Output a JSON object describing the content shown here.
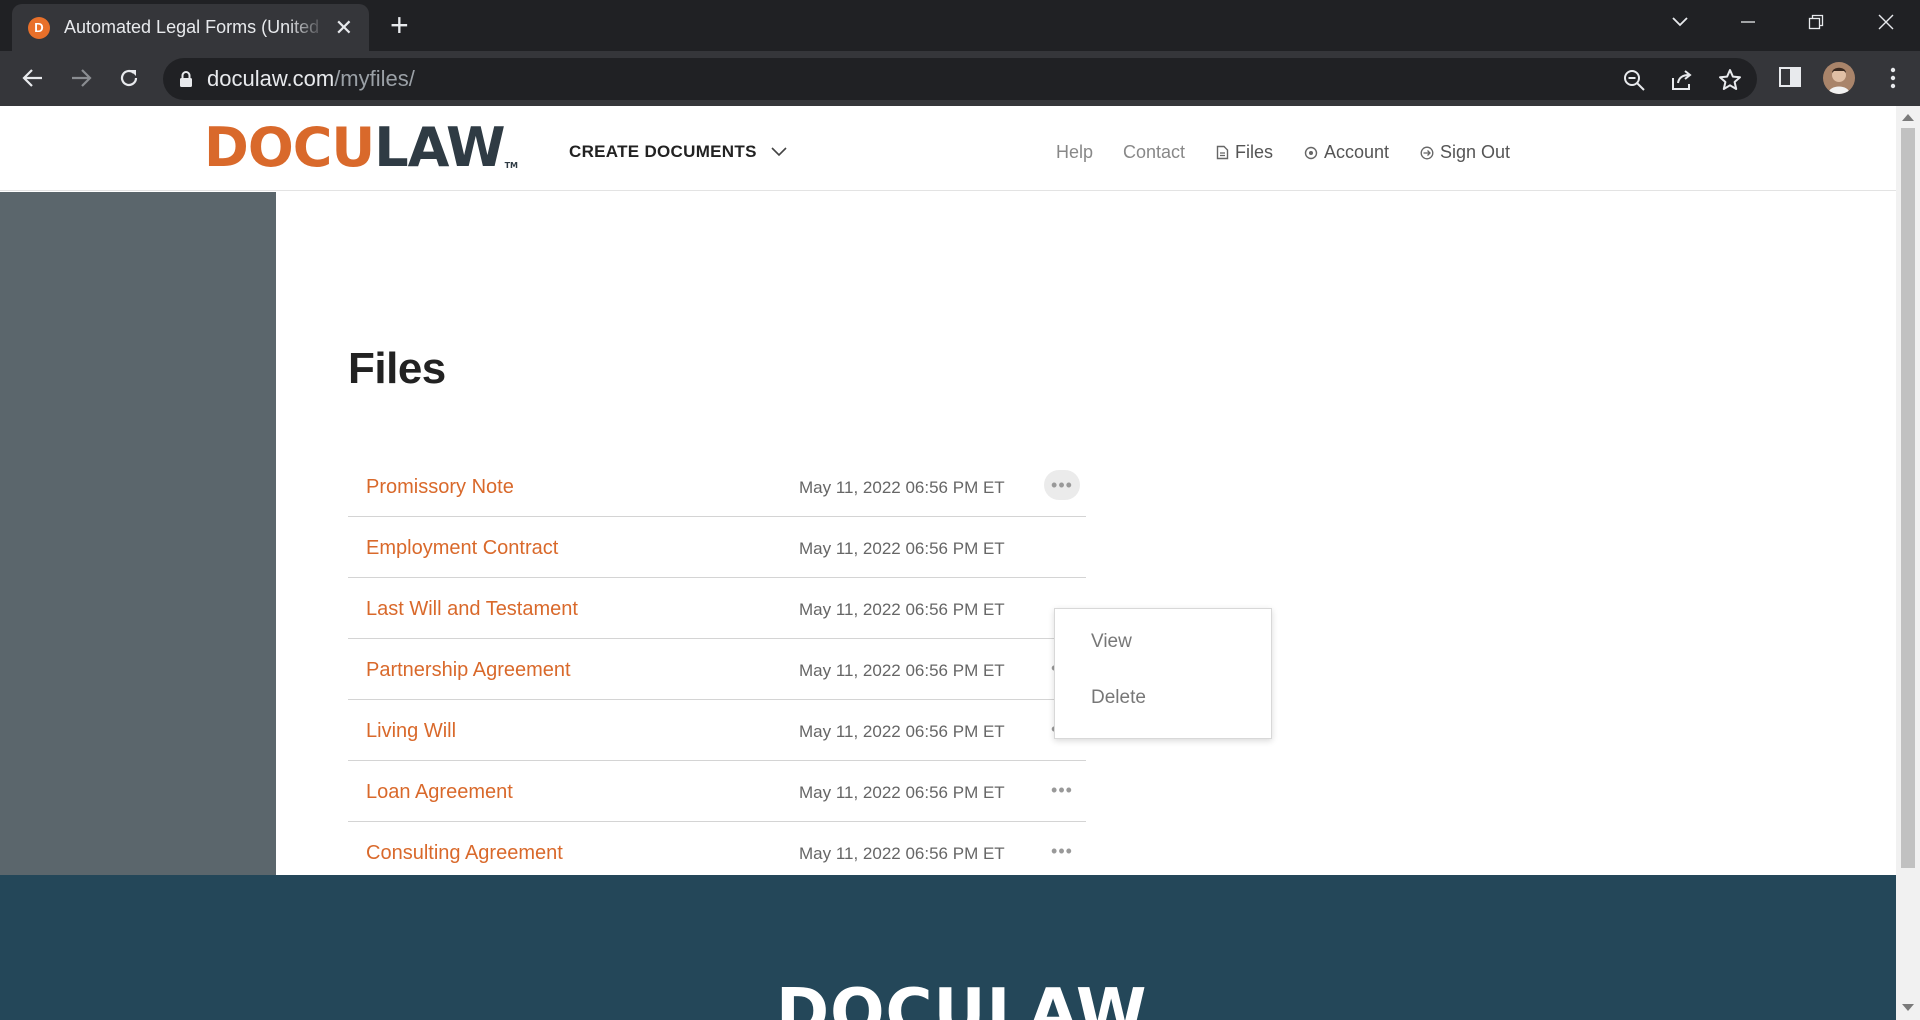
{
  "browser": {
    "tab_title": "Automated Legal Forms (United States)",
    "favicon_letter": "D",
    "url_host": "doculaw.com",
    "url_path": "/myfiles/"
  },
  "header": {
    "logo_part1": "DOCU",
    "logo_part2": "LAW",
    "logo_tm": "TM",
    "create_documents": "CREATE DOCUMENTS",
    "nav": {
      "help": "Help",
      "contact": "Contact",
      "files": "Files",
      "account": "Account",
      "sign_out": "Sign Out"
    }
  },
  "main": {
    "title": "Files",
    "files": [
      {
        "name": "Promissory Note",
        "date": "May 11, 2022 06:56 PM ET"
      },
      {
        "name": "Employment Contract",
        "date": "May 11, 2022 06:56 PM ET"
      },
      {
        "name": "Last Will and Testament",
        "date": "May 11, 2022 06:56 PM ET"
      },
      {
        "name": "Partnership Agreement",
        "date": "May 11, 2022 06:56 PM ET"
      },
      {
        "name": "Living Will",
        "date": "May 11, 2022 06:56 PM ET"
      },
      {
        "name": "Loan Agreement",
        "date": "May 11, 2022 06:56 PM ET"
      },
      {
        "name": "Consulting Agreement",
        "date": "May 11, 2022 06:56 PM ET"
      }
    ],
    "more_glyph": "•••",
    "menu": {
      "view": "View",
      "delete": "Delete"
    }
  },
  "footer": {
    "logo": "DOCULAW"
  },
  "colors": {
    "brand_orange": "#d9692b",
    "sidebar": "#5b666c",
    "footer": "#244759"
  }
}
